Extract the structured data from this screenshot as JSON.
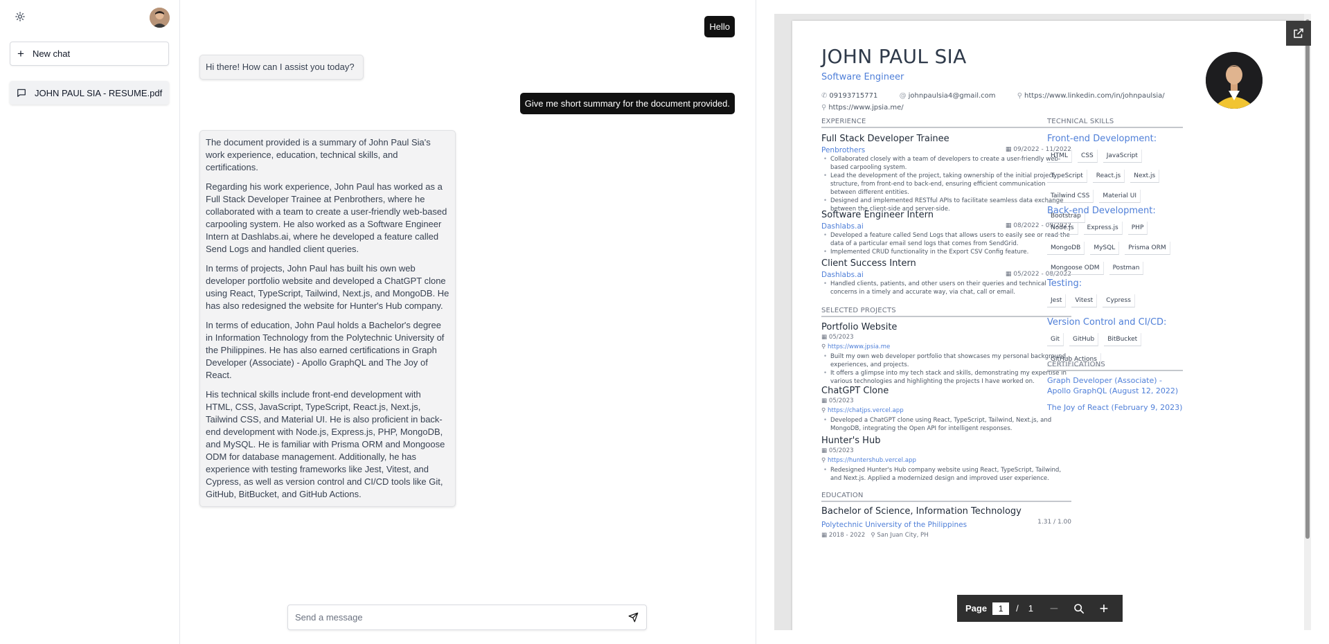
{
  "sidebar": {
    "theme_icon": "sun-icon",
    "new_chat_label": "New chat",
    "chats": [
      {
        "label": "JOHN PAUL SIA - RESUME.pdf",
        "icon": "chat-bubble-icon"
      }
    ]
  },
  "chat": {
    "messages": [
      {
        "role": "user",
        "text": "Hello"
      },
      {
        "role": "assistant",
        "paragraphs": [
          "Hi there! How can I assist you today?"
        ]
      },
      {
        "role": "user",
        "text": "Give me short summary for the document provided."
      },
      {
        "role": "assistant",
        "paragraphs": [
          "The document provided is a summary of John Paul Sia's work experience, education, technical skills, and certifications.",
          "Regarding his work experience, John Paul has worked as a Full Stack Developer Trainee at Penbrothers, where he collaborated with a team to create a user-friendly web-based carpooling system. He also worked as a Software Engineer Intern at Dashlabs.ai, where he developed a feature called Send Logs and handled client queries.",
          "In terms of projects, John Paul has built his own web developer portfolio website and developed a ChatGPT clone using React, TypeScript, Tailwind, Next.js, and MongoDB. He has also redesigned the website for Hunter's Hub company.",
          "In terms of education, John Paul holds a Bachelor's degree in Information Technology from the Polytechnic University of the Philippines. He has also earned certifications in Graph Developer (Associate) - Apollo GraphQL and The Joy of React.",
          "His technical skills include front-end development with HTML, CSS, JavaScript, TypeScript, React.js, Next.js, Tailwind CSS, and Material UI. He is also proficient in back-end development with Node.js, Express.js, PHP, MongoDB, and MySQL. He is familiar with Prisma ORM and Mongoose ODM for database management. Additionally, he has experience with testing frameworks like Jest, Vitest, and Cypress, as well as version control and CI/CD tools like Git, GitHub, BitBucket, and GitHub Actions."
        ]
      }
    ],
    "composer": {
      "placeholder": "Send a message",
      "value": ""
    }
  },
  "pdf": {
    "toolbar": {
      "page_label": "Page",
      "current_page": "1",
      "separator": "/",
      "total_pages": "1"
    },
    "resume": {
      "name": "JOHN PAUL SIA",
      "title": "Software Engineer",
      "phone": "09193715771",
      "email": "johnpaulsia4@gmail.com",
      "linkedin": "https://www.linkedin.com/in/johnpaulsia/",
      "website": "https://www.jpsia.me/",
      "sections": {
        "experience": "EXPERIENCE",
        "projects": "SELECTED PROJECTS",
        "education": "EDUCATION",
        "skills": "TECHNICAL SKILLS",
        "certifications": "CERTIFICATIONS"
      },
      "jobs": [
        {
          "title": "Full Stack Developer Trainee",
          "company": "Penbrothers",
          "date": "09/2022 - 11/2022",
          "bullets": [
            "Collaborated closely with a team of developers to create a user-friendly web-based carpooling system.",
            "Lead the development of the project, taking ownership of the initial project structure, from front-end to back-end, ensuring efficient communication between different entities.",
            "Designed and implemented RESTful APIs to facilitate seamless data exchange between the client-side and server-side."
          ]
        },
        {
          "title": "Software Engineer Intern",
          "company": "Dashlabs.ai",
          "date": "08/2022 - 09/2022",
          "bullets": [
            "Developed a feature called Send Logs that allows users to easily see or read the data of a particular email send logs that comes from SendGrid.",
            "Implemented CRUD functionality in the Export CSV Config feature."
          ]
        },
        {
          "title": "Client Success Intern",
          "company": "Dashlabs.ai",
          "date": "05/2022 - 08/2022",
          "bullets": [
            "Handled clients, patients, and other users on their queries and technical concerns in a timely and accurate way, via chat, call or email."
          ]
        }
      ],
      "projects": [
        {
          "title": "Portfolio Website",
          "date": "05/2023",
          "link": "https://www.jpsia.me",
          "bullets": [
            "Built my own web developer portfolio that showcases my personal background, experiences, and projects.",
            "It offers a glimpse into my tech stack and skills, demonstrating my expertise in various technologies and highlighting the projects I have worked on."
          ]
        },
        {
          "title": "ChatGPT Clone",
          "date": "05/2023",
          "link": "https://chatjps.vercel.app",
          "bullets": [
            "Developed a ChatGPT clone using React, TypeScript, Tailwind, Next.js, and MongoDB, integrating the Open API for intelligent responses."
          ]
        },
        {
          "title": "Hunter's Hub",
          "date": "05/2023",
          "link": "https://huntershub.vercel.app",
          "bullets": [
            "Redesigned Hunter's Hub company website using React, TypeScript, Tailwind, and Next.js. Applied a modernized design and improved user experience."
          ]
        }
      ],
      "education": {
        "degree": "Bachelor of Science, Information Technology",
        "school": "Polytechnic University of the Philippines",
        "years": "2018 - 2022",
        "location": "San Juan City, PH",
        "gpa": "1.31 / 1.00"
      },
      "skills": [
        {
          "heading": "Front-end Development:",
          "items": [
            "HTML",
            "CSS",
            "JavaScript",
            "TypeScript",
            "React.js",
            "Next.js",
            "Tailwind CSS",
            "Material UI",
            "Bootstrap"
          ]
        },
        {
          "heading": "Back-end Development:",
          "items": [
            "Node.js",
            "Express.js",
            "PHP",
            "MongoDB",
            "MySQL",
            "Prisma ORM",
            "Mongoose ODM",
            "Postman"
          ]
        },
        {
          "heading": "Testing:",
          "items": [
            "Jest",
            "Vitest",
            "Cypress"
          ]
        },
        {
          "heading": "Version Control and CI/CD:",
          "items": [
            "Git",
            "GitHub",
            "BitBucket",
            "GitHub Actions"
          ]
        }
      ],
      "certifications": [
        "Graph Developer (Associate) - Apollo GraphQL (August 12, 2022)",
        "The Joy of React (February 9, 2023)"
      ]
    }
  },
  "colors": {
    "accent_blue": "#4f7fd8",
    "user_bubble": "#111111",
    "toolbar": "#2f2f2f"
  }
}
